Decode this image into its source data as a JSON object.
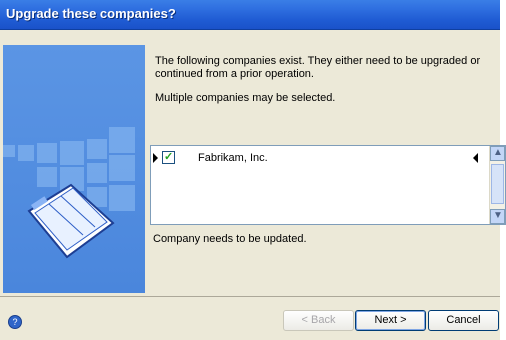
{
  "window": {
    "title": "Upgrade these companies?"
  },
  "content": {
    "message_line1": "The following companies exist. They either need to be upgraded or continued from a prior operation.",
    "message_line2": "Multiple companies may be selected.",
    "companies": [
      {
        "name": "Fabrikam, Inc.",
        "checked": true
      }
    ],
    "status_text": "Company needs to be updated."
  },
  "footer": {
    "back_label": "< Back",
    "next_label": "Next >",
    "cancel_label": "Cancel",
    "help_icon": "help-icon"
  },
  "colors": {
    "titlebar": "#2f6fe0",
    "sidepanel": "#4a86dc",
    "dialog_bg": "#ece9d8"
  }
}
